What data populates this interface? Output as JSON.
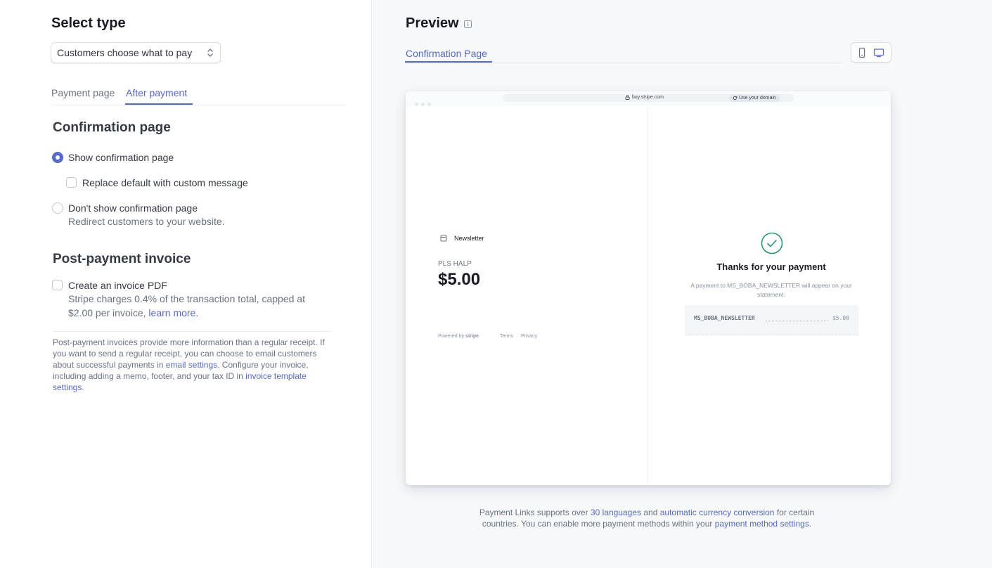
{
  "settings": {
    "select_type_heading": "Select type",
    "select_type_value": "Customers choose what to pay",
    "tabs": [
      {
        "label": "Payment page"
      },
      {
        "label": "After payment"
      }
    ],
    "confirmation_heading": "Confirmation page",
    "show_confirmation_label": "Show confirmation page",
    "replace_default_label": "Replace default with custom message",
    "dont_show_label": "Don't show confirmation page",
    "dont_show_sub": "Redirect customers to your website.",
    "post_payment_heading": "Post-payment invoice",
    "invoice_pdf_label": "Create an invoice PDF",
    "invoice_pdf_sub": "Stripe charges 0.4% of the transaction total, capped at $2.00 per invoice,",
    "invoice_pdf_link": "learn more",
    "invoice_pdf_end": ".",
    "note": {
      "part1": "Post-payment invoices provide more information than a regular receipt. If you want to send a regular receipt, you can choose to email customers about successful payments in",
      "link1": "email settings",
      "part2": ". Configure your invoice, including adding a memo, footer, and your tax ID in",
      "link2": "invoice template settings",
      "part3": "."
    }
  },
  "preview": {
    "heading": "Preview",
    "tab": "Confirmation Page",
    "browser": {
      "url": "buy.stripe.com",
      "use_domain": "Use your domain"
    },
    "product": {
      "name": "Newsletter",
      "title": "PLS HALP",
      "price": "$5.00"
    },
    "footer": {
      "powered_by": "Powered by",
      "brand": "stripe",
      "terms": "Terms",
      "privacy": "Privacy"
    },
    "confirmation": {
      "thanks": "Thanks for your payment",
      "statement": "A payment to MS_BOBA_NEWSLETTER will appear on your statement.",
      "receipt_name": "MS_BOBA_NEWSLETTER",
      "receipt_amount": "$5.00"
    },
    "bottom_note": {
      "part1": "Payment Links supports over",
      "link1": "30 languages",
      "part2": "and",
      "link2": "automatic currency conversion",
      "part3": "for certain countries. You can enable more payment methods within your",
      "link3": "payment method settings",
      "part4": "."
    }
  },
  "colors": {
    "accent": "#5469d4",
    "success": "#2c9a6a"
  },
  "icons": {
    "select_chevron": "chevron-up-down-icon",
    "info": "info-icon",
    "mobile": "mobile-device-icon",
    "desktop": "desktop-device-icon",
    "lock": "lock-icon",
    "domain": "refresh-icon",
    "product": "product-image-icon",
    "success": "checkmark-circle-icon"
  }
}
